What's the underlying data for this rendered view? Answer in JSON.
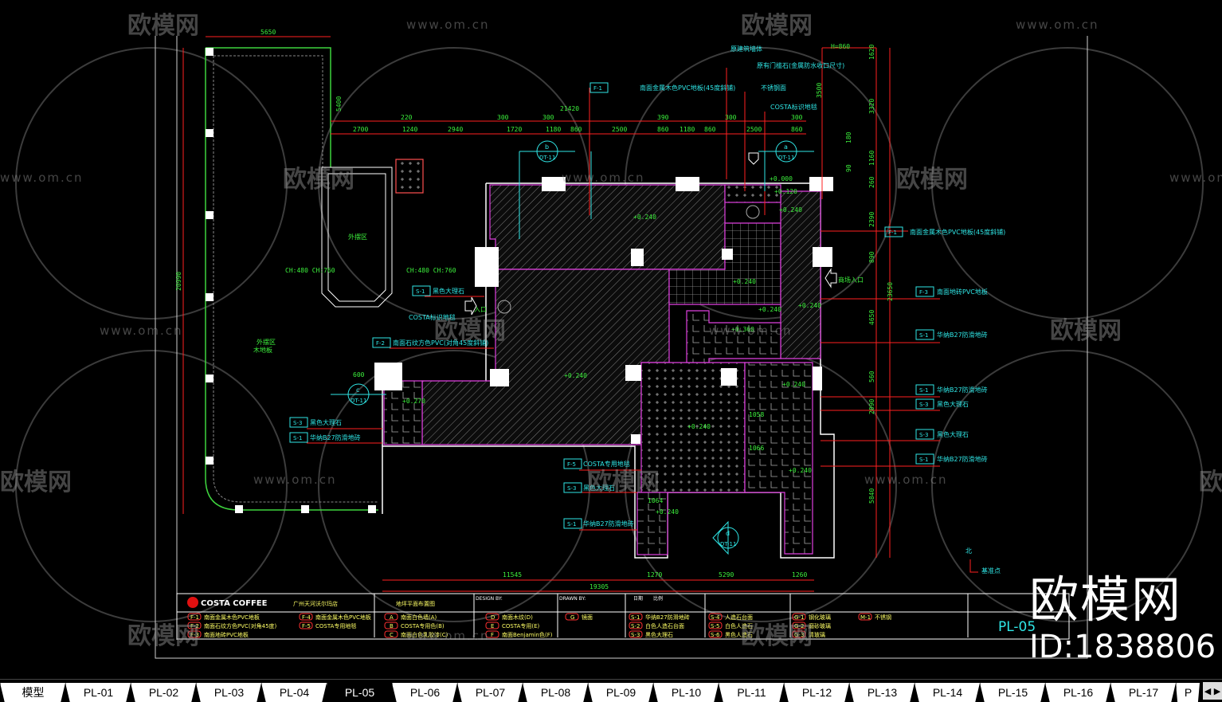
{
  "tabs": [
    "模型",
    "PL-01",
    "PL-02",
    "PL-03",
    "PL-04",
    "PL-05",
    "PL-06",
    "PL-07",
    "PL-08",
    "PL-09",
    "PL-10",
    "PL-11",
    "PL-12",
    "PL-13",
    "PL-14",
    "PL-15",
    "PL-16",
    "PL-17",
    "P"
  ],
  "active_tab": "PL-05",
  "watermark": {
    "brand": "欧模网",
    "url": "www.om.cn",
    "id": "ID:1838806"
  },
  "dimensions": {
    "top_width": "5650",
    "left_gap": "5400",
    "overall_top": "21420",
    "top_row1": [
      "220",
      "300",
      "300",
      "390",
      "300",
      "300"
    ],
    "top_row2": [
      "2700",
      "1240",
      "2940",
      "1720",
      "1180",
      "860",
      "2500",
      "860",
      "1180",
      "860",
      "2500",
      "860"
    ],
    "left_height": "20990",
    "right_chain": [
      "1620",
      "3320",
      "1160",
      "260",
      "2390",
      "890",
      "4650",
      "560",
      "2090",
      "5840"
    ],
    "right_total": "23650",
    "right_small": [
      "180",
      "90"
    ],
    "door_height": "H=860",
    "vertical_3500": "3500",
    "bottom_chain": [
      "11545",
      "1270",
      "5290",
      "1260"
    ],
    "bottom_total": "19305",
    "small_600": "600",
    "small_1064": "1064",
    "small_1058": "1058",
    "small_1066": "1066"
  },
  "elevations": [
    "+0.000",
    "+0.120",
    "+0.240",
    "+0.240",
    "+0.240",
    "+0.240",
    "+0.240",
    "+0.360",
    "+0.240",
    "+0.240",
    "+0.240",
    "+0.240",
    "+0.270",
    "+0.240"
  ],
  "callouts": [
    {
      "code": "F-1",
      "text": "南面金属木色PVC地板(45度斜铺)"
    },
    {
      "code": "F-1",
      "text": "南面金属木色PVC地板(45度斜铺)"
    },
    {
      "code": "F-3",
      "text": "南面地砖PVC地板"
    },
    {
      "code": "S-1",
      "text": "华纳B27防滑地砖"
    },
    {
      "code": "S-1",
      "text": "华纳B27防滑地砖"
    },
    {
      "code": "S-3",
      "text": "黑色大理石"
    },
    {
      "code": "S-3",
      "text": "黑色大理石"
    },
    {
      "code": "S-1",
      "text": "华纳B27防滑地砖"
    },
    {
      "code": "S-1",
      "text": "黑色大理石"
    },
    {
      "code": "F-2",
      "text": "南面石纹方色PVC(对角45度斜铺)"
    },
    {
      "code": "S-3",
      "text": "黑色大理石"
    },
    {
      "code": "S-1",
      "text": "华纳B27防滑地砖"
    },
    {
      "code": "F-5",
      "text": "COSTA专用地毯"
    },
    {
      "code": "S-3",
      "text": "黑色大理石"
    },
    {
      "code": "S-1",
      "text": "华纳B27防滑地砖"
    }
  ],
  "notes": {
    "wall": "原建筑墙体",
    "threshold": "原有门槛石(金属防水收口尺寸)",
    "steel": "不锈钢面",
    "logo_carpet_top": "COSTA标识地毯",
    "logo_carpet_left": "COSTA标识地毯",
    "entrance_left": "入口",
    "entrance_right": "商场入口",
    "kiosk": "外摆区",
    "outdoor": "外摆区",
    "outdoor2": "木地板",
    "ch_left": "CH:480\nCH:760",
    "ch_right": "CH:480\nCH:760",
    "datum": "基准点",
    "north": "北"
  },
  "sections": [
    {
      "letter": "b",
      "ref": "DT-11"
    },
    {
      "letter": "a",
      "ref": "DT-11"
    },
    {
      "letter": "c",
      "ref": "DT-11"
    },
    {
      "letter": "d",
      "ref": "DT-11"
    }
  ],
  "title_block": {
    "brand": "COSTA COFFEE",
    "project": "广州天河沃尔玛店",
    "drawing_title": "地坪平面布置图",
    "design_by": "DESIGN BY:",
    "drawn_by": "DRAWN BY:",
    "date_label": "日期",
    "scale_label": "比例",
    "sheet_no": "PL-05",
    "legend_group1": [
      {
        "code": "F-1",
        "text": "南面金属木色PVC地板"
      },
      {
        "code": "F-2",
        "text": "南面石纹方色PVC(对角45度)"
      },
      {
        "code": "F-3",
        "text": "南面地砖PVC地板"
      },
      {
        "code": "F-4",
        "text": "南面金属木色PVC地板"
      },
      {
        "code": "F-5",
        "text": "COSTA专用地毯"
      }
    ],
    "legend_group2": [
      {
        "code": "A",
        "text": "南面白色墙(A)"
      },
      {
        "code": "B",
        "text": "COSTA专用色(B)"
      },
      {
        "code": "C",
        "text": "南面白色乳胶漆(C)"
      },
      {
        "code": "D",
        "text": "南面木纹(D)"
      },
      {
        "code": "E",
        "text": "COSTA专用(E)"
      },
      {
        "code": "F",
        "text": "南面Benjamin色(F)"
      },
      {
        "code": "G",
        "text": "镜面"
      }
    ],
    "legend_group3": [
      {
        "code": "S-1",
        "text": "华纳B27防滑地砖"
      },
      {
        "code": "S-2",
        "text": "白色人造石台面"
      },
      {
        "code": "S-3",
        "text": "黑色大理石"
      },
      {
        "code": "S-4",
        "text": "人造石台面"
      },
      {
        "code": "S-5",
        "text": "白色人造石"
      },
      {
        "code": "S-6",
        "text": "黑色人造石"
      }
    ],
    "legend_group4": [
      {
        "code": "G-1",
        "text": "钢化玻璃"
      },
      {
        "code": "G-2",
        "text": "磨砂玻璃"
      },
      {
        "code": "G-3",
        "text": "清玻璃"
      },
      {
        "code": "M-1",
        "text": "不锈钢"
      }
    ]
  },
  "colors": {
    "background": "#000000",
    "dimension": "#ff2020",
    "dim_text": "#3cf03c",
    "annotation": "#2fe6e6",
    "floor_outline": "#e040e0",
    "wall": "#ffffff",
    "title_text": "#ffff66"
  }
}
